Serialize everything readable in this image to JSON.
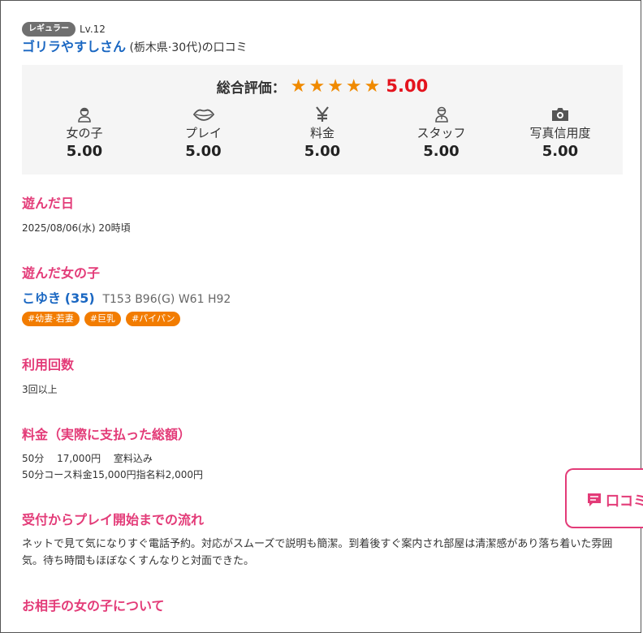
{
  "reviewer": {
    "rank_badge": "レギュラー",
    "level": "Lv.12",
    "name": "ゴリラやすしさん",
    "info": " (栃木県·30代)の口コミ"
  },
  "rating": {
    "overall_label": "総合評価：",
    "stars": "★★★★★",
    "overall_score": "5.00",
    "categories": [
      {
        "icon": "girl-icon",
        "label": "女の子",
        "score": "5.00"
      },
      {
        "icon": "lips-icon",
        "label": "プレイ",
        "score": "5.00"
      },
      {
        "icon": "yen-icon",
        "label": "料金",
        "score": "5.00"
      },
      {
        "icon": "staff-icon",
        "label": "スタッフ",
        "score": "5.00"
      },
      {
        "icon": "camera-icon",
        "label": "写真信用度",
        "score": "5.00"
      }
    ]
  },
  "visit_date": {
    "title": "遊んだ日",
    "value": "2025/08/06(水) 20時頃"
  },
  "girl": {
    "title": "遊んだ女の子",
    "name": "こゆき",
    "age": "(35)",
    "stats": "T153 B96(G) W61 H92",
    "tags": [
      "#幼妻·若妻",
      "#巨乳",
      "#パイパン"
    ]
  },
  "usage": {
    "title": "利用回数",
    "value": "3回以上"
  },
  "price": {
    "title": "料金（実際に支払った総額）",
    "line1": "50分　 17,000円　 室料込み",
    "line2": "50分コース料金15,000円指名料2,000円"
  },
  "flow": {
    "title": "受付からプレイ開始までの流れ",
    "text": "ネットで見て気になりすぐ電話予約。対応がスムーズで説明も簡潔。到着後すぐ案内され部屋は清潔感があり落ち着いた雰囲気。待ち時間もほぼなくすんなりと対面できた。"
  },
  "about_girl": {
    "title": "お相手の女の子について"
  },
  "floating_button": {
    "label": "口コミ"
  }
}
